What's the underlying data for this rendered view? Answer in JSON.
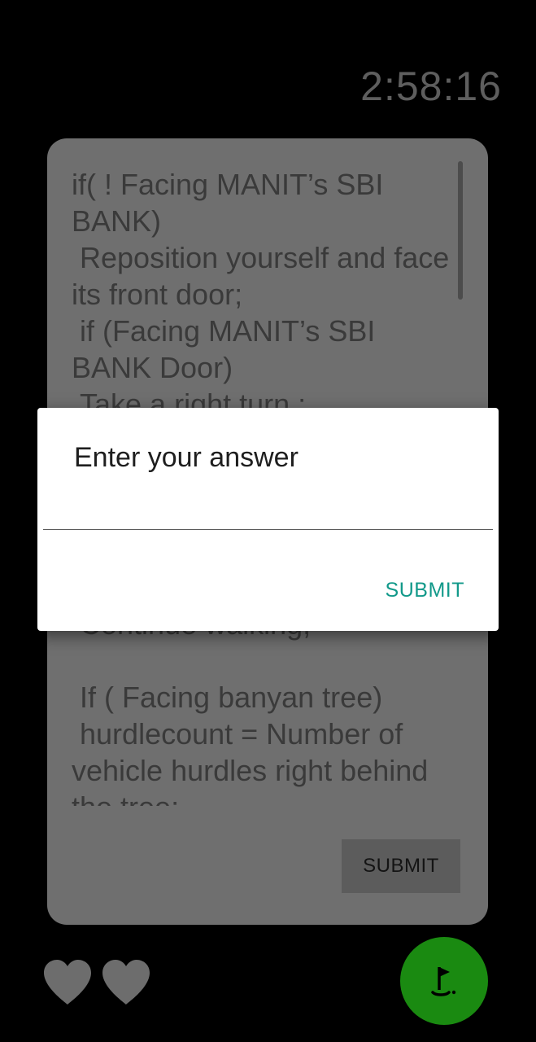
{
  "timer": {
    "value": "2:58:16"
  },
  "puzzle": {
    "text": "if( ! Facing MANIT’s SBI BANK)\n Reposition yourself and face its front door;\n if (Facing MANIT’s SBI BANK Door)\n Take a right turn ;\n\n\n\n\n\n Continue walking;\n\n If ( Facing banyan tree)\n hurdlecount = Number of vehicle hurdles right behind the tree;",
    "submit_label": "SUBMIT"
  },
  "dialog": {
    "title": "Enter your answer",
    "input_value": "",
    "input_placeholder": "",
    "submit_label": "SUBMIT",
    "accent_color": "#12998a"
  },
  "lives": {
    "count": 2,
    "icons": [
      "heart-icon",
      "heart-icon"
    ]
  },
  "fab": {
    "icon": "golf-flag-icon",
    "color": "#1a8a11"
  }
}
